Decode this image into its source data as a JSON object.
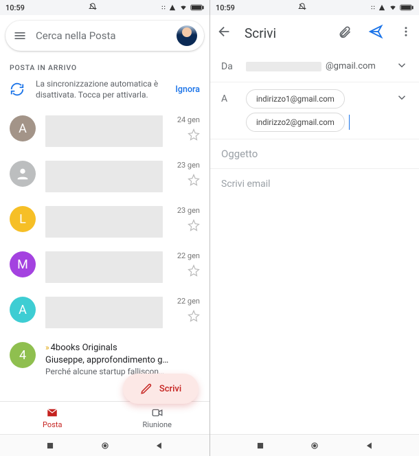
{
  "status": {
    "time": "10:59"
  },
  "left": {
    "search_placeholder": "Cerca nella Posta",
    "section_label": "POSTA IN ARRIVO",
    "notice_text": "La sincronizzazione automatica è disattivata. Tocca per attivarla.",
    "notice_action": "Ignora",
    "rows": [
      {
        "letter": "A",
        "color": "#a39488",
        "date": "24 gen"
      },
      {
        "letter": "",
        "color": "#bcbebf",
        "date": "23 gen"
      },
      {
        "letter": "L",
        "color": "#f6bf26",
        "date": "23 gen"
      },
      {
        "letter": "M",
        "color": "#a442e0",
        "date": "22 gen"
      },
      {
        "letter": "A",
        "color": "#3ecdd3",
        "date": "22 gen"
      }
    ],
    "row6": {
      "letter": "4",
      "color": "#8fbf4f",
      "tag": "4books Originals",
      "line1": "Giuseppe, approfondimento g…",
      "line2": "Perché alcune startup falliscon…"
    },
    "fab_label": "Scrivi",
    "tabs": {
      "posta": "Posta",
      "riunione": "Riunione"
    }
  },
  "right": {
    "title": "Scrivi",
    "from_label": "Da",
    "from_suffix": "@gmail.com",
    "to_label": "A",
    "chips": [
      "indirizzo1@gmail.com",
      "indirizzo2@gmail.com"
    ],
    "subject_placeholder": "Oggetto",
    "body_placeholder": "Scrivi email"
  }
}
